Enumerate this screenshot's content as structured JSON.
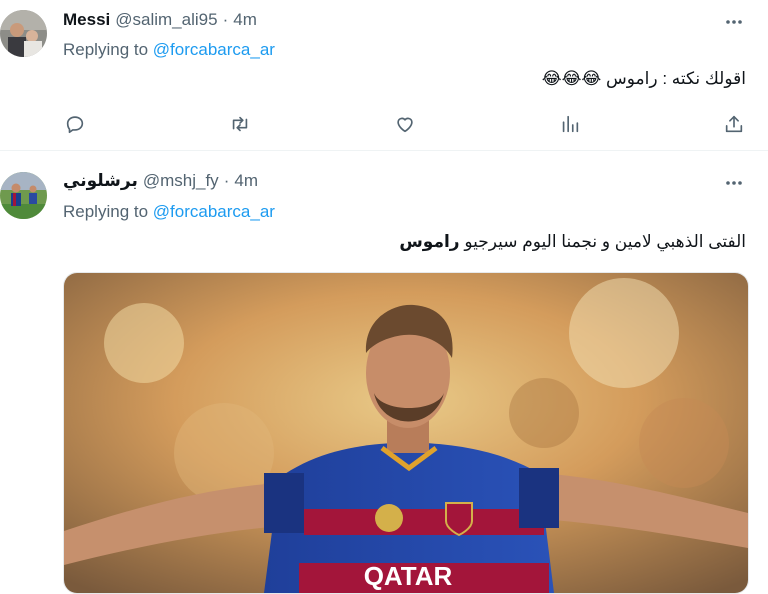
{
  "tweet1": {
    "name": "Messi",
    "handle": "@salim_ali95",
    "separator": "·",
    "time": "4m",
    "replying_prefix": "Replying to",
    "replying_handle": "@forcabarca_ar",
    "text": "اقولك نكته : راموس 😂😂😂"
  },
  "tweet2": {
    "name": "برشلوني",
    "handle": "@mshj_fy",
    "separator": "·",
    "time": "4m",
    "replying_prefix": "Replying to",
    "replying_handle": "@forcabarca_ar",
    "text_main": "الفتى الذهبي لامين و نجمنا اليوم سيرجيو",
    "text_bold": "راموس",
    "jersey_sponsor": "QATAR"
  },
  "colors": {
    "accent": "#1d9bf0",
    "secondary_text": "#536471",
    "icon": "#536471"
  },
  "icons": [
    "more-icon",
    "reply-icon",
    "retweet-icon",
    "like-icon",
    "views-icon",
    "share-icon"
  ]
}
